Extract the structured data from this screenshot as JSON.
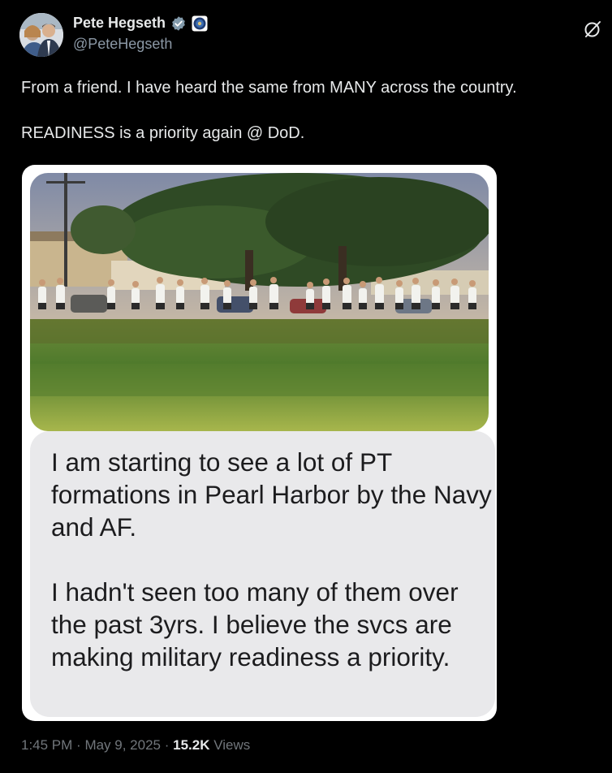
{
  "author": {
    "display_name": "Pete Hegseth",
    "handle": "@PeteHegseth",
    "verified_color": "#829aab"
  },
  "icons": {
    "verified": "verified-badge-icon",
    "affiliation": "dod-seal-icon",
    "grok": "grok-icon"
  },
  "tweet": {
    "text": "From a friend. I have heard the same from MANY across the country.\n\nREADINESS is a priority again @ DoD."
  },
  "media": {
    "photo_alt": "group-pt-formation-photo",
    "message_paragraphs": [
      "I am starting to see a lot of PT formations in Pearl Harbor by the Navy and AF.",
      "I hadn't seen too many of them over the past 3yrs.  I believe the svcs are making military readiness a priority."
    ]
  },
  "meta": {
    "time": "1:45 PM",
    "date": "May 9, 2025",
    "views_count": "15.2K",
    "views_label": "Views"
  }
}
